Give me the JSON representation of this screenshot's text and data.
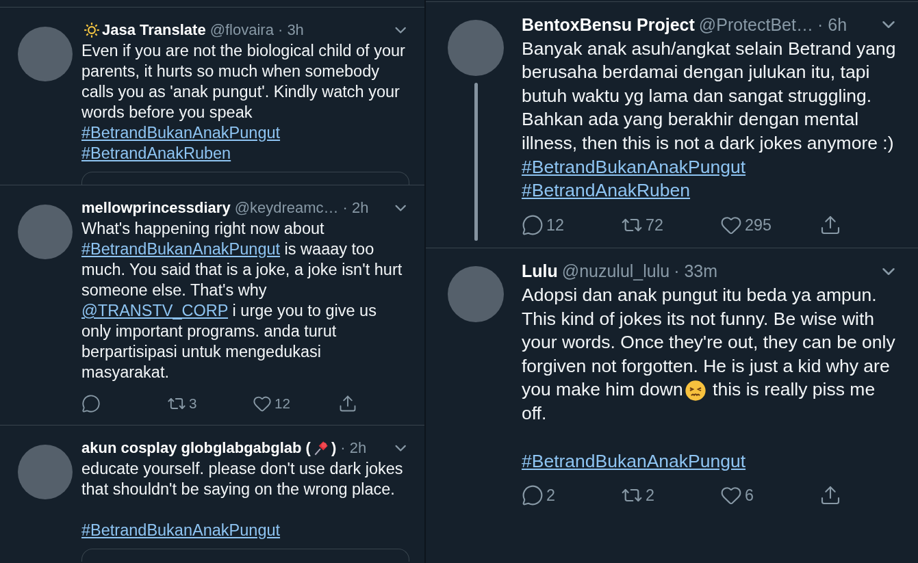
{
  "columns": [
    {
      "tweets": [
        {
          "name": [
            {
              "kind": "sun"
            },
            {
              "kind": "text",
              "text": "Jasa Translate"
            }
          ],
          "handle": "@flovaira",
          "time": "· 3h",
          "thread_line": false,
          "quote_card_peek": true,
          "body": [
            {
              "segments": [
                {
                  "kind": "text",
                  "text": "Even if you are not the biological child of your parents, it hurts so much when somebody calls you as 'anak pungut'. Kindly watch your words before you speak"
                }
              ]
            },
            {
              "segments": [
                {
                  "kind": "link",
                  "text": "#BetrandBukanAnakPungut"
                }
              ]
            },
            {
              "segments": [
                {
                  "kind": "link",
                  "text": "#BetrandAnakRuben"
                }
              ]
            }
          ]
        },
        {
          "name": [
            {
              "kind": "text",
              "text": "mellowprincessdiary"
            }
          ],
          "handle": "@keydreamc…",
          "time": "· 2h",
          "thread_line": false,
          "quote_card_peek": false,
          "body": [
            {
              "segments": [
                {
                  "kind": "text",
                  "text": "What's happening right now about "
                },
                {
                  "kind": "link",
                  "text": "#BetrandBukanAnakPungut"
                },
                {
                  "kind": "text",
                  "text": " is waaay too much. You said that is a joke, a joke isn't hurt someone else. That's why "
                },
                {
                  "kind": "link",
                  "text": "@TRANSTV_CORP"
                },
                {
                  "kind": "text",
                  "text": " i urge you to give us only important programs. anda turut berpartisipasi untuk mengedukasi masyarakat."
                }
              ]
            }
          ],
          "stats": [
            {
              "kind": "reply"
            },
            {
              "kind": "retweet",
              "count": "3"
            },
            {
              "kind": "like",
              "count": "12"
            },
            {
              "kind": "share"
            }
          ]
        },
        {
          "name": [
            {
              "kind": "text",
              "text": "akun cosplay globglabgabglab ("
            },
            {
              "kind": "pin"
            },
            {
              "kind": "text",
              "text": ")"
            }
          ],
          "time": "· 2h",
          "thread_line": false,
          "quote_card_peek": true,
          "body": [
            {
              "segments": [
                {
                  "kind": "text",
                  "text": "educate yourself. please don't use dark jokes that shouldn't be saying on the wrong place."
                }
              ]
            },
            {
              "spaced": true,
              "segments": [
                {
                  "kind": "link",
                  "text": "#BetrandBukanAnakPungut"
                }
              ]
            }
          ]
        }
      ]
    },
    {
      "tweets": [
        {
          "name": [
            {
              "kind": "text",
              "text": "BentoxBensu Project"
            }
          ],
          "handle": "@ProtectBet…",
          "time": "· 6h",
          "thread_line": true,
          "quote_card_peek": false,
          "body": [
            {
              "segments": [
                {
                  "kind": "text",
                  "text": "Banyak anak asuh/angkat selain Betrand yang berusaha berdamai dengan julukan itu, tapi butuh waktu yg lama dan sangat struggling. Bahkan ada yang berakhir dengan mental illness, then this is not a dark jokes anymore :)"
                }
              ]
            },
            {
              "segments": [
                {
                  "kind": "link",
                  "text": "#BetrandBukanAnakPungut"
                }
              ]
            },
            {
              "segments": [
                {
                  "kind": "link",
                  "text": "#BetrandAnakRuben"
                }
              ]
            }
          ],
          "stats": [
            {
              "kind": "reply",
              "count": "12"
            },
            {
              "kind": "retweet",
              "count": "72"
            },
            {
              "kind": "like",
              "count": "295"
            },
            {
              "kind": "share"
            }
          ]
        },
        {
          "name": [
            {
              "kind": "text",
              "text": "Lulu"
            }
          ],
          "handle": "@nuzulul_lulu",
          "time": "· 33m",
          "thread_line": false,
          "quote_card_peek": false,
          "body": [
            {
              "segments": [
                {
                  "kind": "text",
                  "text": "Adopsi dan anak pungut itu beda ya ampun. This kind of jokes its not funny. Be wise with your words. Once they're out, they can be only forgiven not forgotten. He is just a kid why are you make him down"
                },
                {
                  "kind": "emoji"
                },
                {
                  "kind": "text",
                  "text": " this is really piss me off."
                }
              ]
            },
            {
              "spaced": true,
              "segments": [
                {
                  "kind": "link",
                  "text": "#BetrandBukanAnakPungut"
                }
              ]
            }
          ],
          "stats": [
            {
              "kind": "reply",
              "count": "2"
            },
            {
              "kind": "retweet",
              "count": "2"
            },
            {
              "kind": "like",
              "count": "6"
            },
            {
              "kind": "share"
            }
          ]
        }
      ]
    }
  ]
}
